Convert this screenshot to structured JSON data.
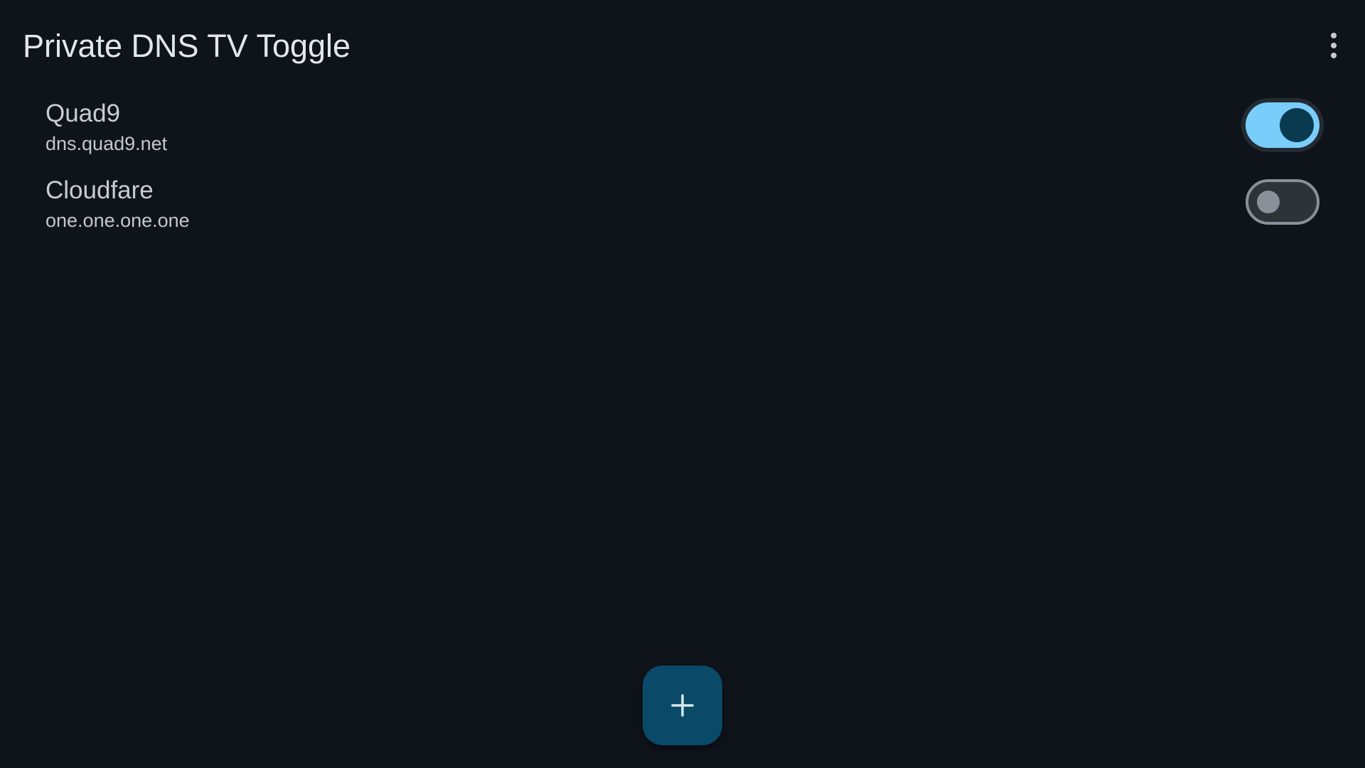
{
  "app_bar": {
    "title": "Private DNS TV Toggle",
    "overflow_icon": "more-vert-icon"
  },
  "dns_entries": [
    {
      "name": "Quad9",
      "host": "dns.quad9.net",
      "enabled": true
    },
    {
      "name": "Cloudfare",
      "host": "one.one.one.one",
      "enabled": false
    }
  ],
  "fab": {
    "icon": "plus-icon"
  },
  "colors": {
    "background": "#0f141b",
    "switch_on_track": "#79cdfb",
    "switch_on_thumb": "#0a3a4f",
    "switch_off_track": "#2e3338",
    "switch_off_outline": "#8a9097",
    "fab_background": "#0a4a68"
  }
}
